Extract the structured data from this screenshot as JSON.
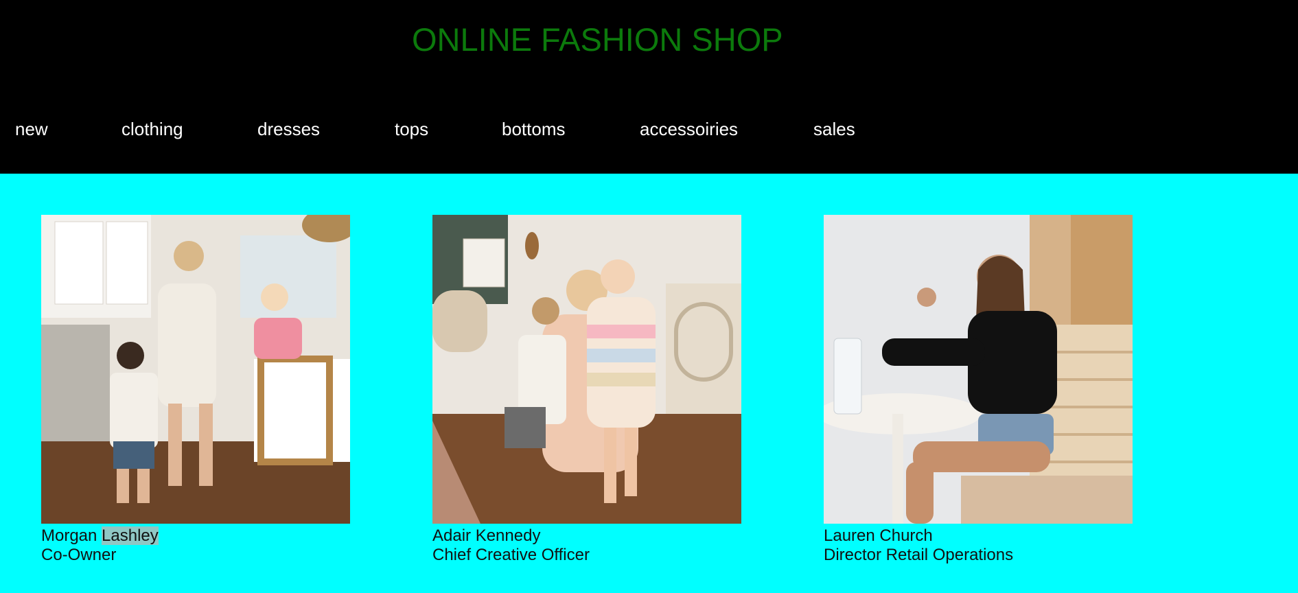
{
  "site": {
    "title": "ONLINE FASHION SHOP"
  },
  "nav": {
    "items": [
      {
        "label": "new"
      },
      {
        "label": "clothing"
      },
      {
        "label": "dresses"
      },
      {
        "label": "tops"
      },
      {
        "label": "bottoms"
      },
      {
        "label": "accessoiries"
      },
      {
        "label": "sales"
      }
    ]
  },
  "team": [
    {
      "first": "Morgan",
      "last": "Lashley",
      "role": "Co-Owner"
    },
    {
      "first": "Adair",
      "last": "Kennedy",
      "role": "Chief Creative Officer"
    },
    {
      "first": "Lauren",
      "last": "Church",
      "role": "Director Retail Operations"
    }
  ],
  "colors": {
    "page_background": "#00ffff",
    "header_background": "#000000",
    "title_color": "#0c7a0c",
    "nav_text": "#ffffff",
    "text_highlight": "#8fc7c4"
  }
}
